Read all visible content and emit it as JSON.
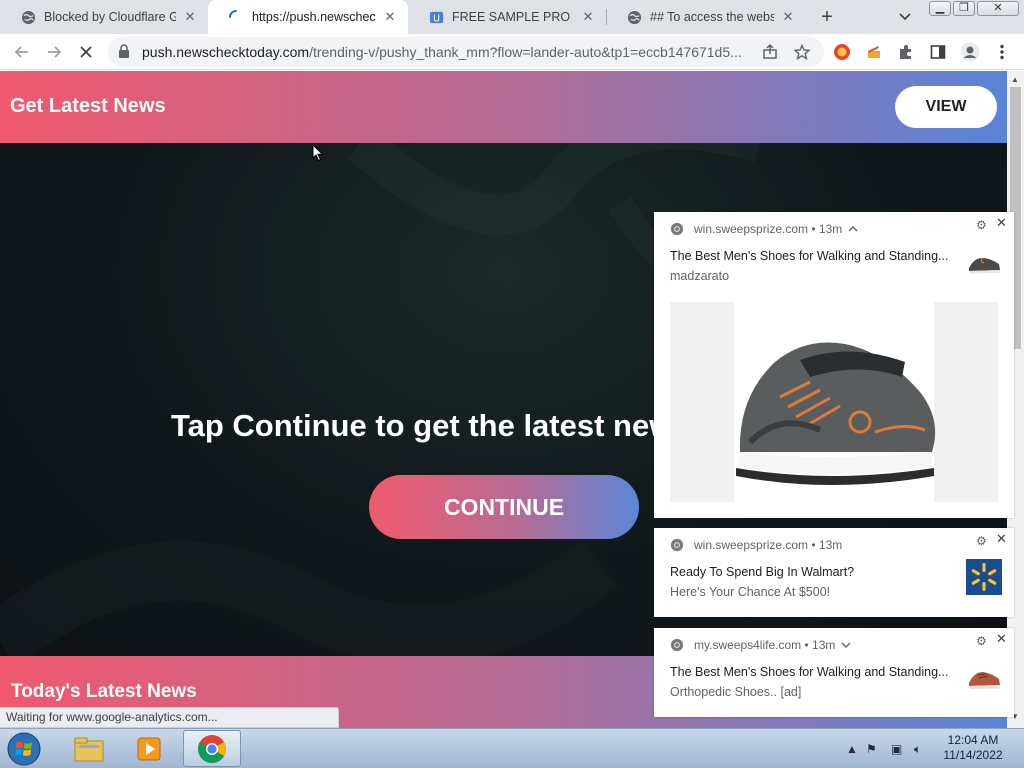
{
  "tabs": [
    {
      "title": "Blocked by Cloudflare Ga",
      "favicon": "globe-icon",
      "active": false
    },
    {
      "title": "https://push.newscheckto",
      "favicon": "loading-spinner-icon",
      "active": true
    },
    {
      "title": "FREE SAMPLE PRO USA",
      "favicon": "site-favicon-icon",
      "active": false
    },
    {
      "title": "## To access the website",
      "favicon": "globe-icon",
      "active": false
    }
  ],
  "toolbar": {
    "url_host": "push.newschecktoday.com",
    "url_path": "/trending-v/pushy_thank_mm?flow=lander-auto&tp1=eccb147671d5..."
  },
  "page": {
    "site_title": "Get Latest News",
    "view_label": "VIEW",
    "headline": "Tap Continue to get the latest news",
    "continue_label": "CONTINUE",
    "latest_title": "Today's Latest News"
  },
  "status_text": "Waiting for www.google-analytics.com...",
  "notifications": [
    {
      "source": "win.sweepsprize.com",
      "time": "13m",
      "title": "The Best Men's Shoes for Walking and Standing...",
      "body": "madzarato",
      "thumb": "shoe-thumbnail-icon",
      "image": "shoe-image"
    },
    {
      "source": "win.sweepsprize.com",
      "time": "13m",
      "title": "Ready To Spend Big In Walmart?",
      "body": "Here's Your Chance At $500!",
      "thumb": "walmart-logo-icon"
    },
    {
      "source": "my.sweeps4life.com",
      "time": "13m",
      "title": "The Best Men's Shoes for Walking and Standing...",
      "body": "Orthopedic Shoes.. [ad]",
      "thumb": "shoe-thumbnail-icon"
    }
  ],
  "taskbar": {
    "apps": [
      "windows-explorer-icon",
      "media-player-icon",
      "chrome-icon"
    ],
    "time": "12:04 AM",
    "date": "11/14/2022"
  }
}
